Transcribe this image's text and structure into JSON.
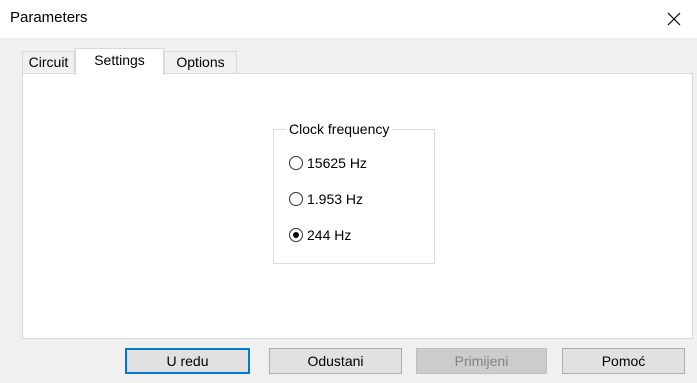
{
  "window": {
    "title": "Parameters",
    "close_glyph": "✕"
  },
  "tabs": [
    {
      "label": "Circuit",
      "active": false
    },
    {
      "label": "Settings",
      "active": true
    },
    {
      "label": "Options",
      "active": false
    }
  ],
  "clock_group": {
    "legend": "Clock frequency",
    "options": [
      {
        "label": "15625 Hz",
        "checked": false
      },
      {
        "label": "1.953 Hz",
        "checked": false
      },
      {
        "label": "244 Hz",
        "checked": true
      }
    ]
  },
  "buttons": {
    "ok": "U redu",
    "cancel": "Odustani",
    "apply": "Primijeni",
    "help": "Pomoć"
  },
  "colors": {
    "default_button_border": "#0078d7",
    "disabled_text": "#838383"
  }
}
